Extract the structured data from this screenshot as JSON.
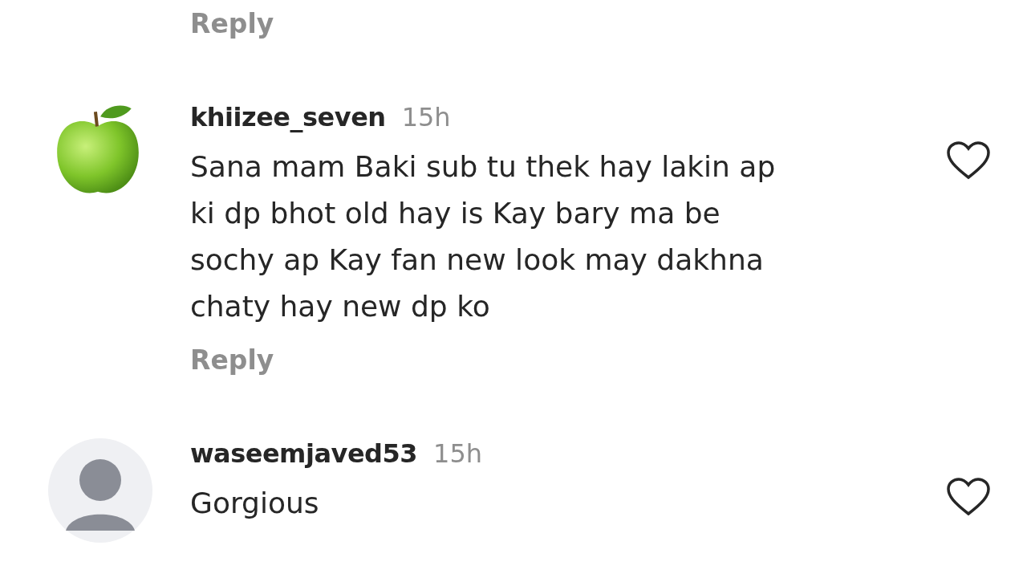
{
  "comments": [
    {
      "reply": "Reply"
    },
    {
      "avatar": {
        "kind": "apple"
      },
      "username": "khiizee_seven",
      "time": "15h",
      "text": "Sana mam Baki sub tu thek hay lakin ap ki dp bhot old hay is Kay bary ma be sochy ap Kay fan new look may dakhna chaty hay new dp ko",
      "reply": "Reply",
      "liked": false
    },
    {
      "avatar": {
        "kind": "default"
      },
      "username": "waseemjaved53",
      "time": "15h",
      "text": "Gorgious",
      "liked": false
    }
  ]
}
